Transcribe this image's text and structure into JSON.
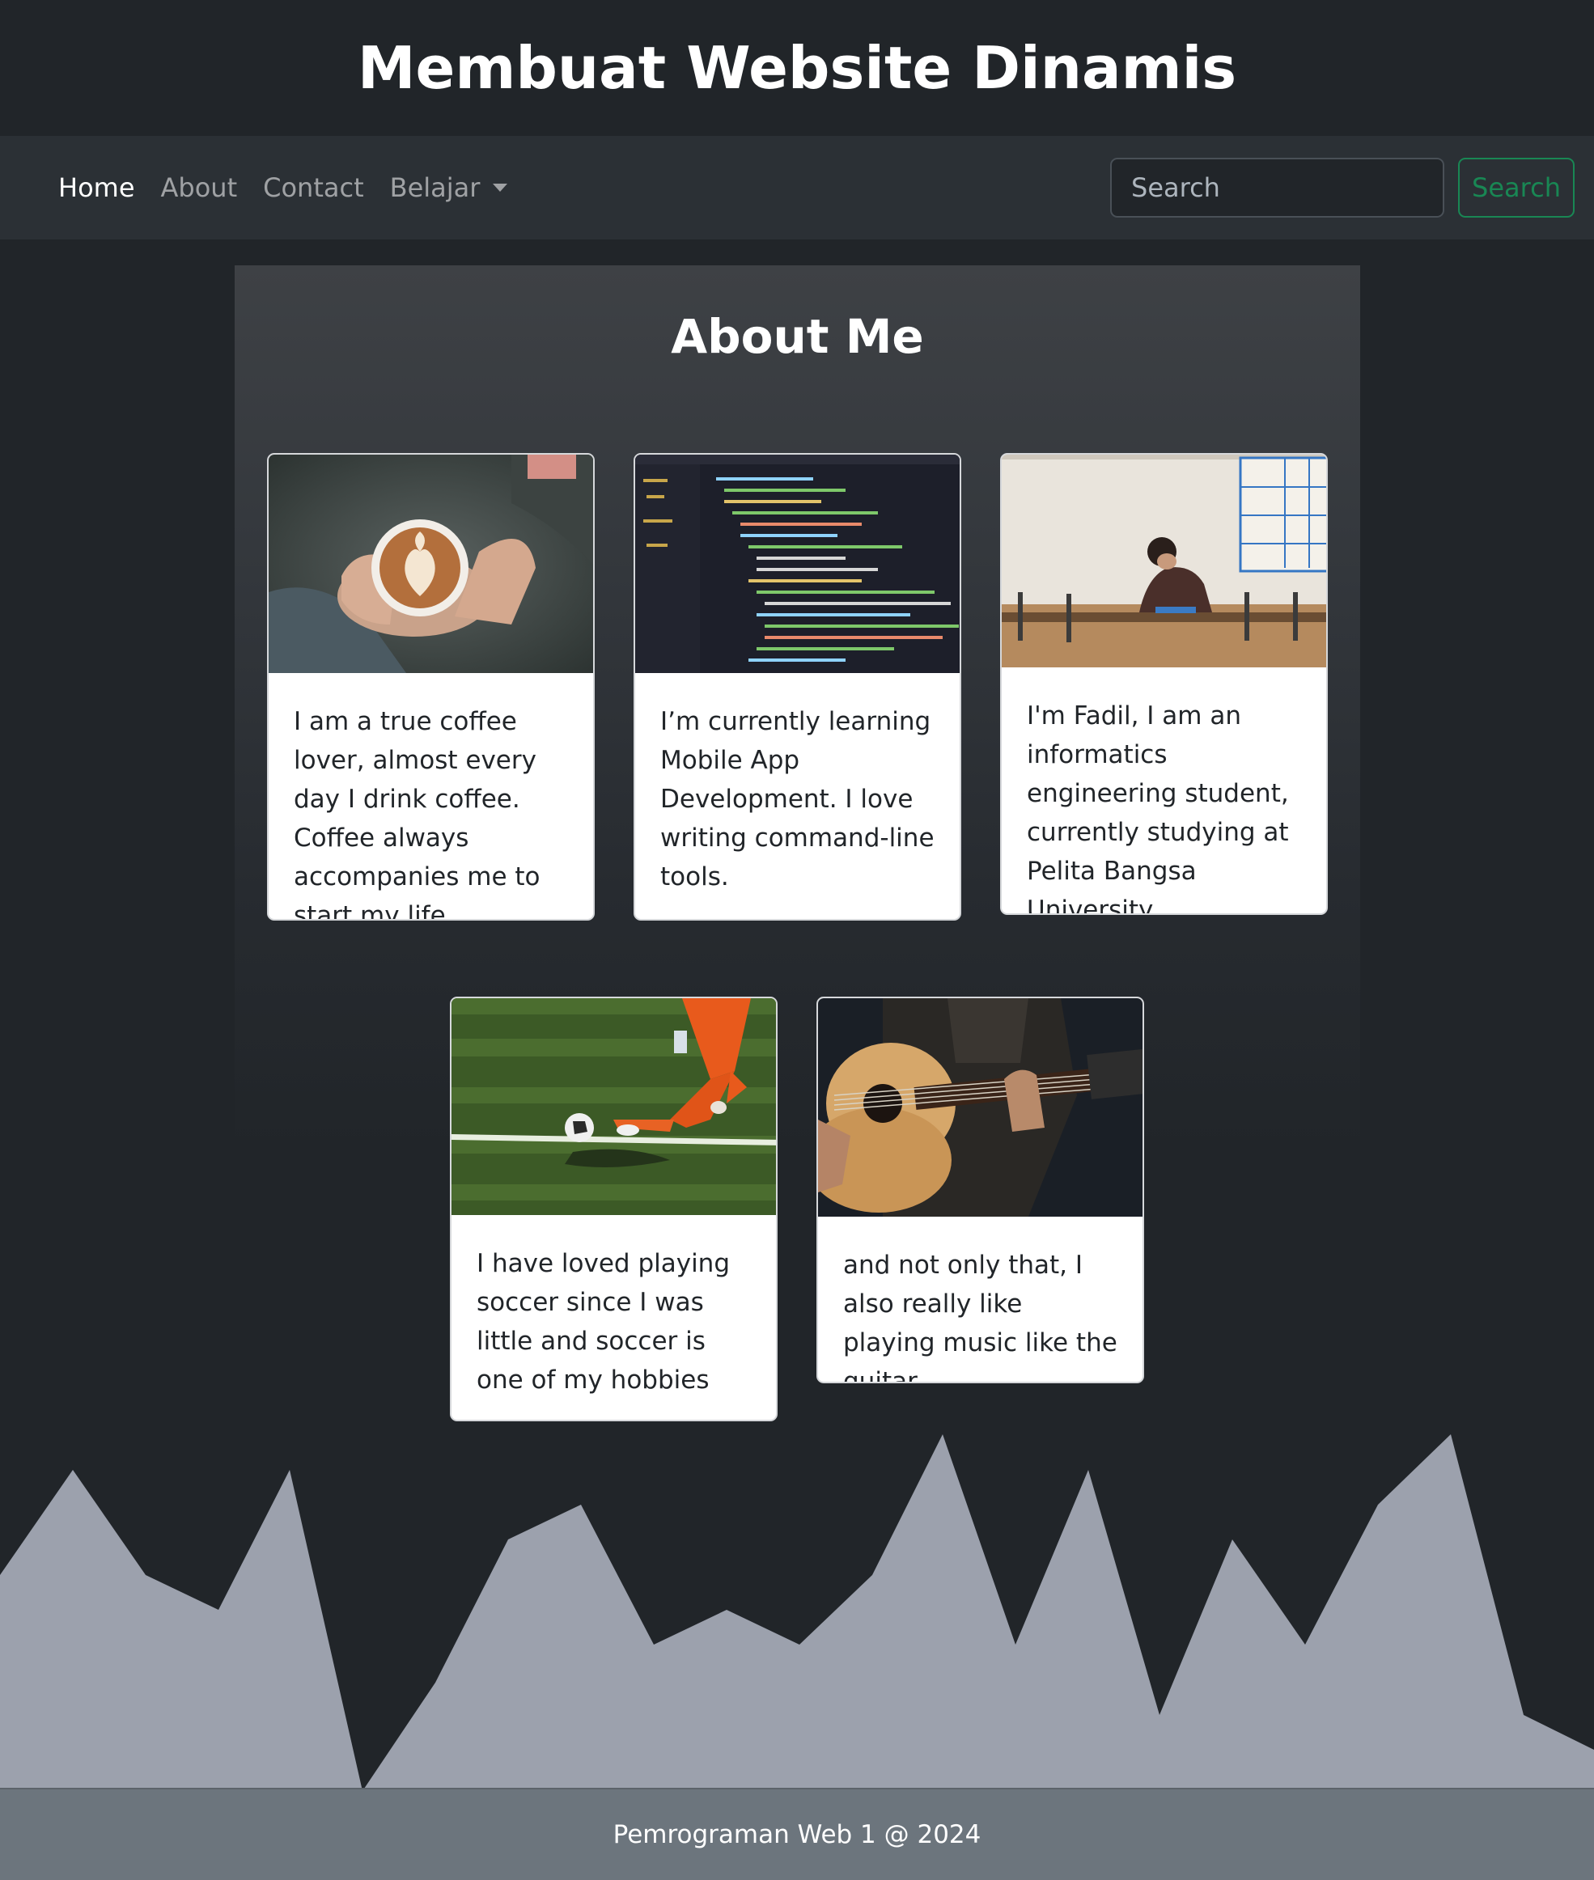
{
  "header": {
    "title": "Membuat Website Dinamis"
  },
  "nav": {
    "items": [
      {
        "label": "Home",
        "active": true
      },
      {
        "label": "About"
      },
      {
        "label": "Contact"
      },
      {
        "label": "Belajar",
        "dropdown": true
      }
    ],
    "search": {
      "placeholder": "Search",
      "button_label": "Search"
    }
  },
  "about": {
    "title": "About Me",
    "cards": [
      {
        "image": "coffee-latte-art-photo",
        "text": "I am a true coffee lover, almost every day I drink coffee. Coffee always accompanies me to start my life."
      },
      {
        "image": "code-editor-screenshot-photo",
        "text": "I’m currently learning Mobile App Development. I love writing command-line tools."
      },
      {
        "image": "student-studying-classroom-photo",
        "text": "I'm Fadil, I am an informatics engineering student, currently studying at Pelita Bangsa University"
      },
      {
        "image": "soccer-player-kicking-ball-photo",
        "text": "I have loved playing soccer since I was little and soccer is one of my hobbies"
      },
      {
        "image": "acoustic-guitar-player-photo",
        "text": "and not only that, I also really like playing music like the guitar."
      }
    ]
  },
  "colors": {
    "background": "#212529",
    "navbar": "#2b3035",
    "search_accent": "#198754",
    "mountain": "#9ca1ad",
    "footer": "#6c757d"
  },
  "footer": {
    "text": "Pemrograman Web 1 @ 2024"
  }
}
